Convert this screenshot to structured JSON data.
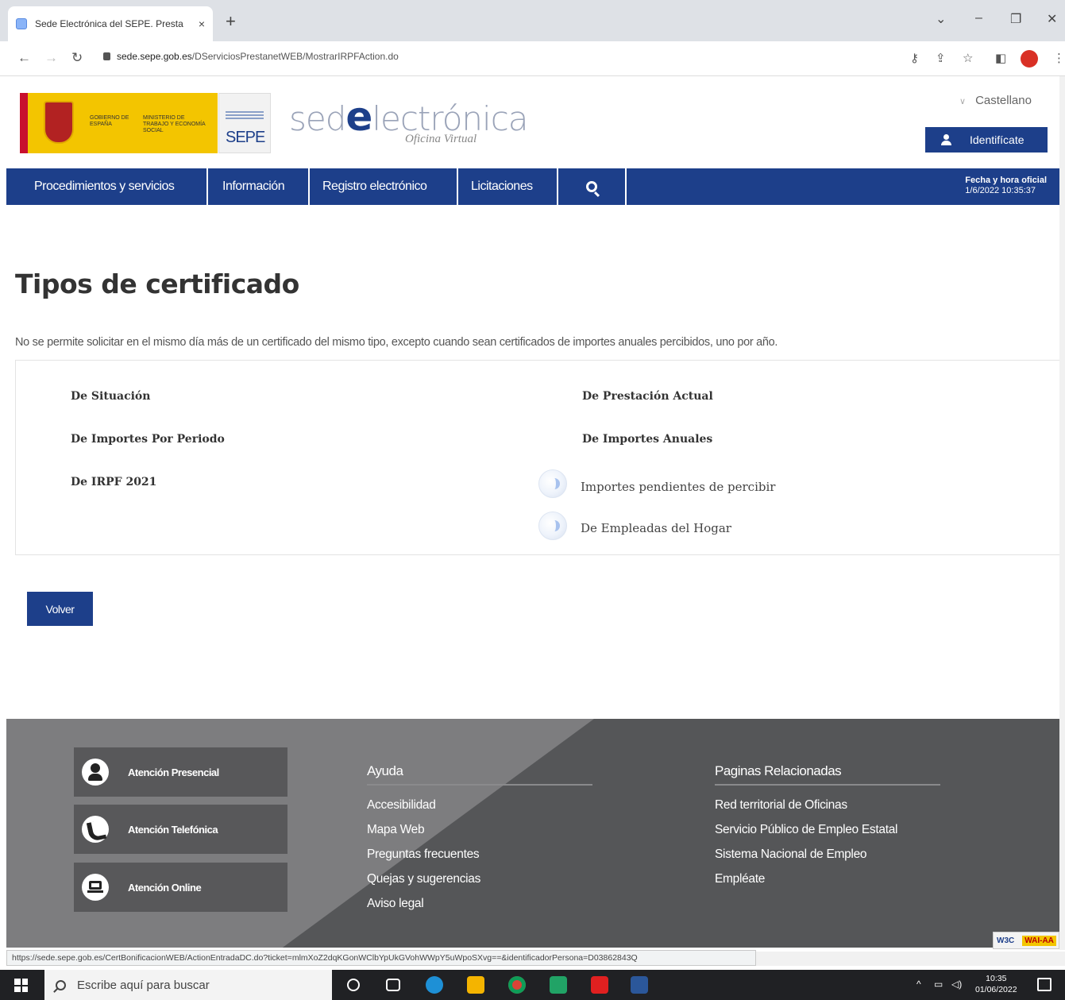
{
  "browser": {
    "tab_title": "Sede Electrónica del SEPE. Presta",
    "tab_close": "×",
    "new_tab": "+",
    "url_domain": "sede.sepe.gob.es",
    "url_path": "/DServiciosPrestanetWEB/MostrarIRPFAction.do",
    "status_url": "https://sede.sepe.gob.es/CertBonificacionWEB/ActionEntradaDC.do?ticket=mlmXoZ2dqKGonWClbYpUkGVohWWpY5uWpoSXvg==&identificadorPersona=D03862843Q"
  },
  "header": {
    "gov_line1": "GOBIERNO DE ESPAÑA",
    "gov_line2": "MINISTERIO DE TRABAJO Y ECONOMÍA SOCIAL",
    "sepe": "SEPE",
    "sede_pre": "sed",
    "sede_e": "e",
    "sede_post": "lectrónica",
    "oficina": "Oficina Virtual",
    "language": "Castellano",
    "identificate": "Identifícate"
  },
  "nav": {
    "items": [
      "Procedimientos y servicios",
      "Información",
      "Registro electrónico",
      "Licitaciones"
    ],
    "fecha_label": "Fecha y hora oficial",
    "fecha_value": "1/6/2022 10:35:37"
  },
  "main": {
    "title": "Tipos de certificado",
    "notice": "No se permite solicitar en el mismo día más de un certificado del mismo tipo, excepto cuando sean certificados de importes anuales percibidos, uno por año.",
    "certs_left": [
      "De Situación",
      "De Importes Por Periodo",
      "De IRPF 2021"
    ],
    "certs_right": [
      "De Prestación Actual",
      "De Importes Anuales"
    ],
    "sub_items": [
      "Importes pendientes de percibir",
      "De Empleadas del Hogar"
    ],
    "volver": "Volver"
  },
  "footer": {
    "contact": [
      "Atención Presencial",
      "Atención Telefónica",
      "Atención Online"
    ],
    "ayuda_title": "Ayuda",
    "ayuda_links": [
      "Accesibilidad",
      "Mapa Web",
      "Preguntas frecuentes",
      "Quejas y sugerencias",
      "Aviso legal"
    ],
    "related_title": "Paginas Relacionadas",
    "related_links": [
      "Red territorial de Oficinas",
      "Servicio Público de Empleo Estatal",
      "Sistema Nacional de Empleo",
      "Empléate"
    ],
    "wai_text": "W3C",
    "wai_badge": "WAI-AA"
  },
  "taskbar": {
    "search_placeholder": "Escribe aquí para buscar",
    "time": "10:35",
    "date": "01/06/2022"
  }
}
